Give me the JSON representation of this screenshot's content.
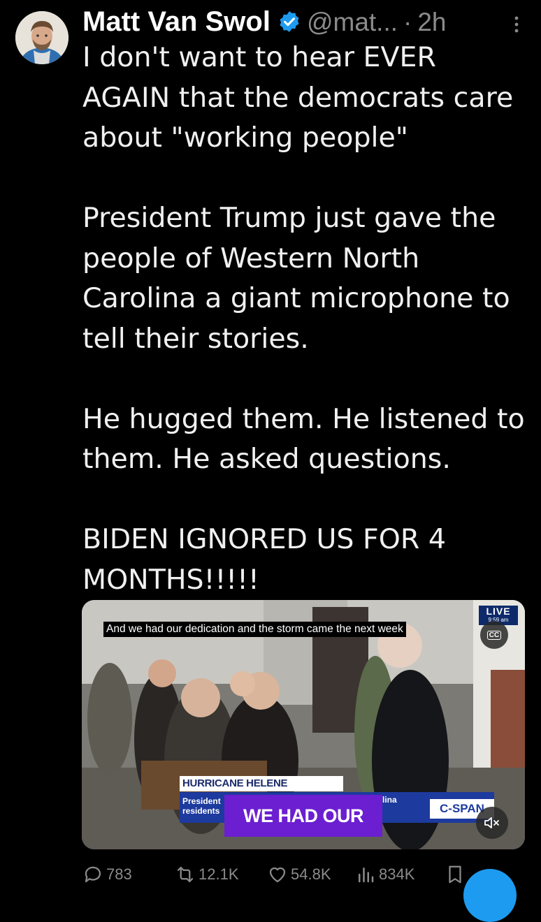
{
  "author": {
    "name": "Matt Van Swol",
    "handle": "@mat...",
    "separator": "·",
    "time": "2h",
    "avatar_icon": "user-avatar"
  },
  "tweet": {
    "paragraphs": [
      "I don't want to hear EVER AGAIN that the democrats care about \"working people\"",
      "President Trump just gave the people of Western North Carolina a giant microphone to tell their stories.",
      "He hugged them. He listened to them. He asked questions.",
      "BIDEN IGNORED US FOR 4 MONTHS!!!!!"
    ]
  },
  "video": {
    "caption": "And we had our dedication and the storm came the next week",
    "live_label": "LIVE",
    "live_time": "9:59 am",
    "cc_label": "CC",
    "banner": "HURRICANE HELENE RECOVERY",
    "lower_third_left_1": "President",
    "lower_third_left_2": "residents",
    "lower_third_right": "lina",
    "overlay_caption": "WE HAD OUR",
    "network": "C-SPAN"
  },
  "actions": {
    "replies": "783",
    "reposts": "12.1K",
    "likes": "54.8K",
    "views": "834K"
  },
  "colors": {
    "background": "#000000",
    "text": "#e7e9ea",
    "muted": "#8b8b8b",
    "verified": "#1d9bf0",
    "accent": "#1d9bf0"
  }
}
